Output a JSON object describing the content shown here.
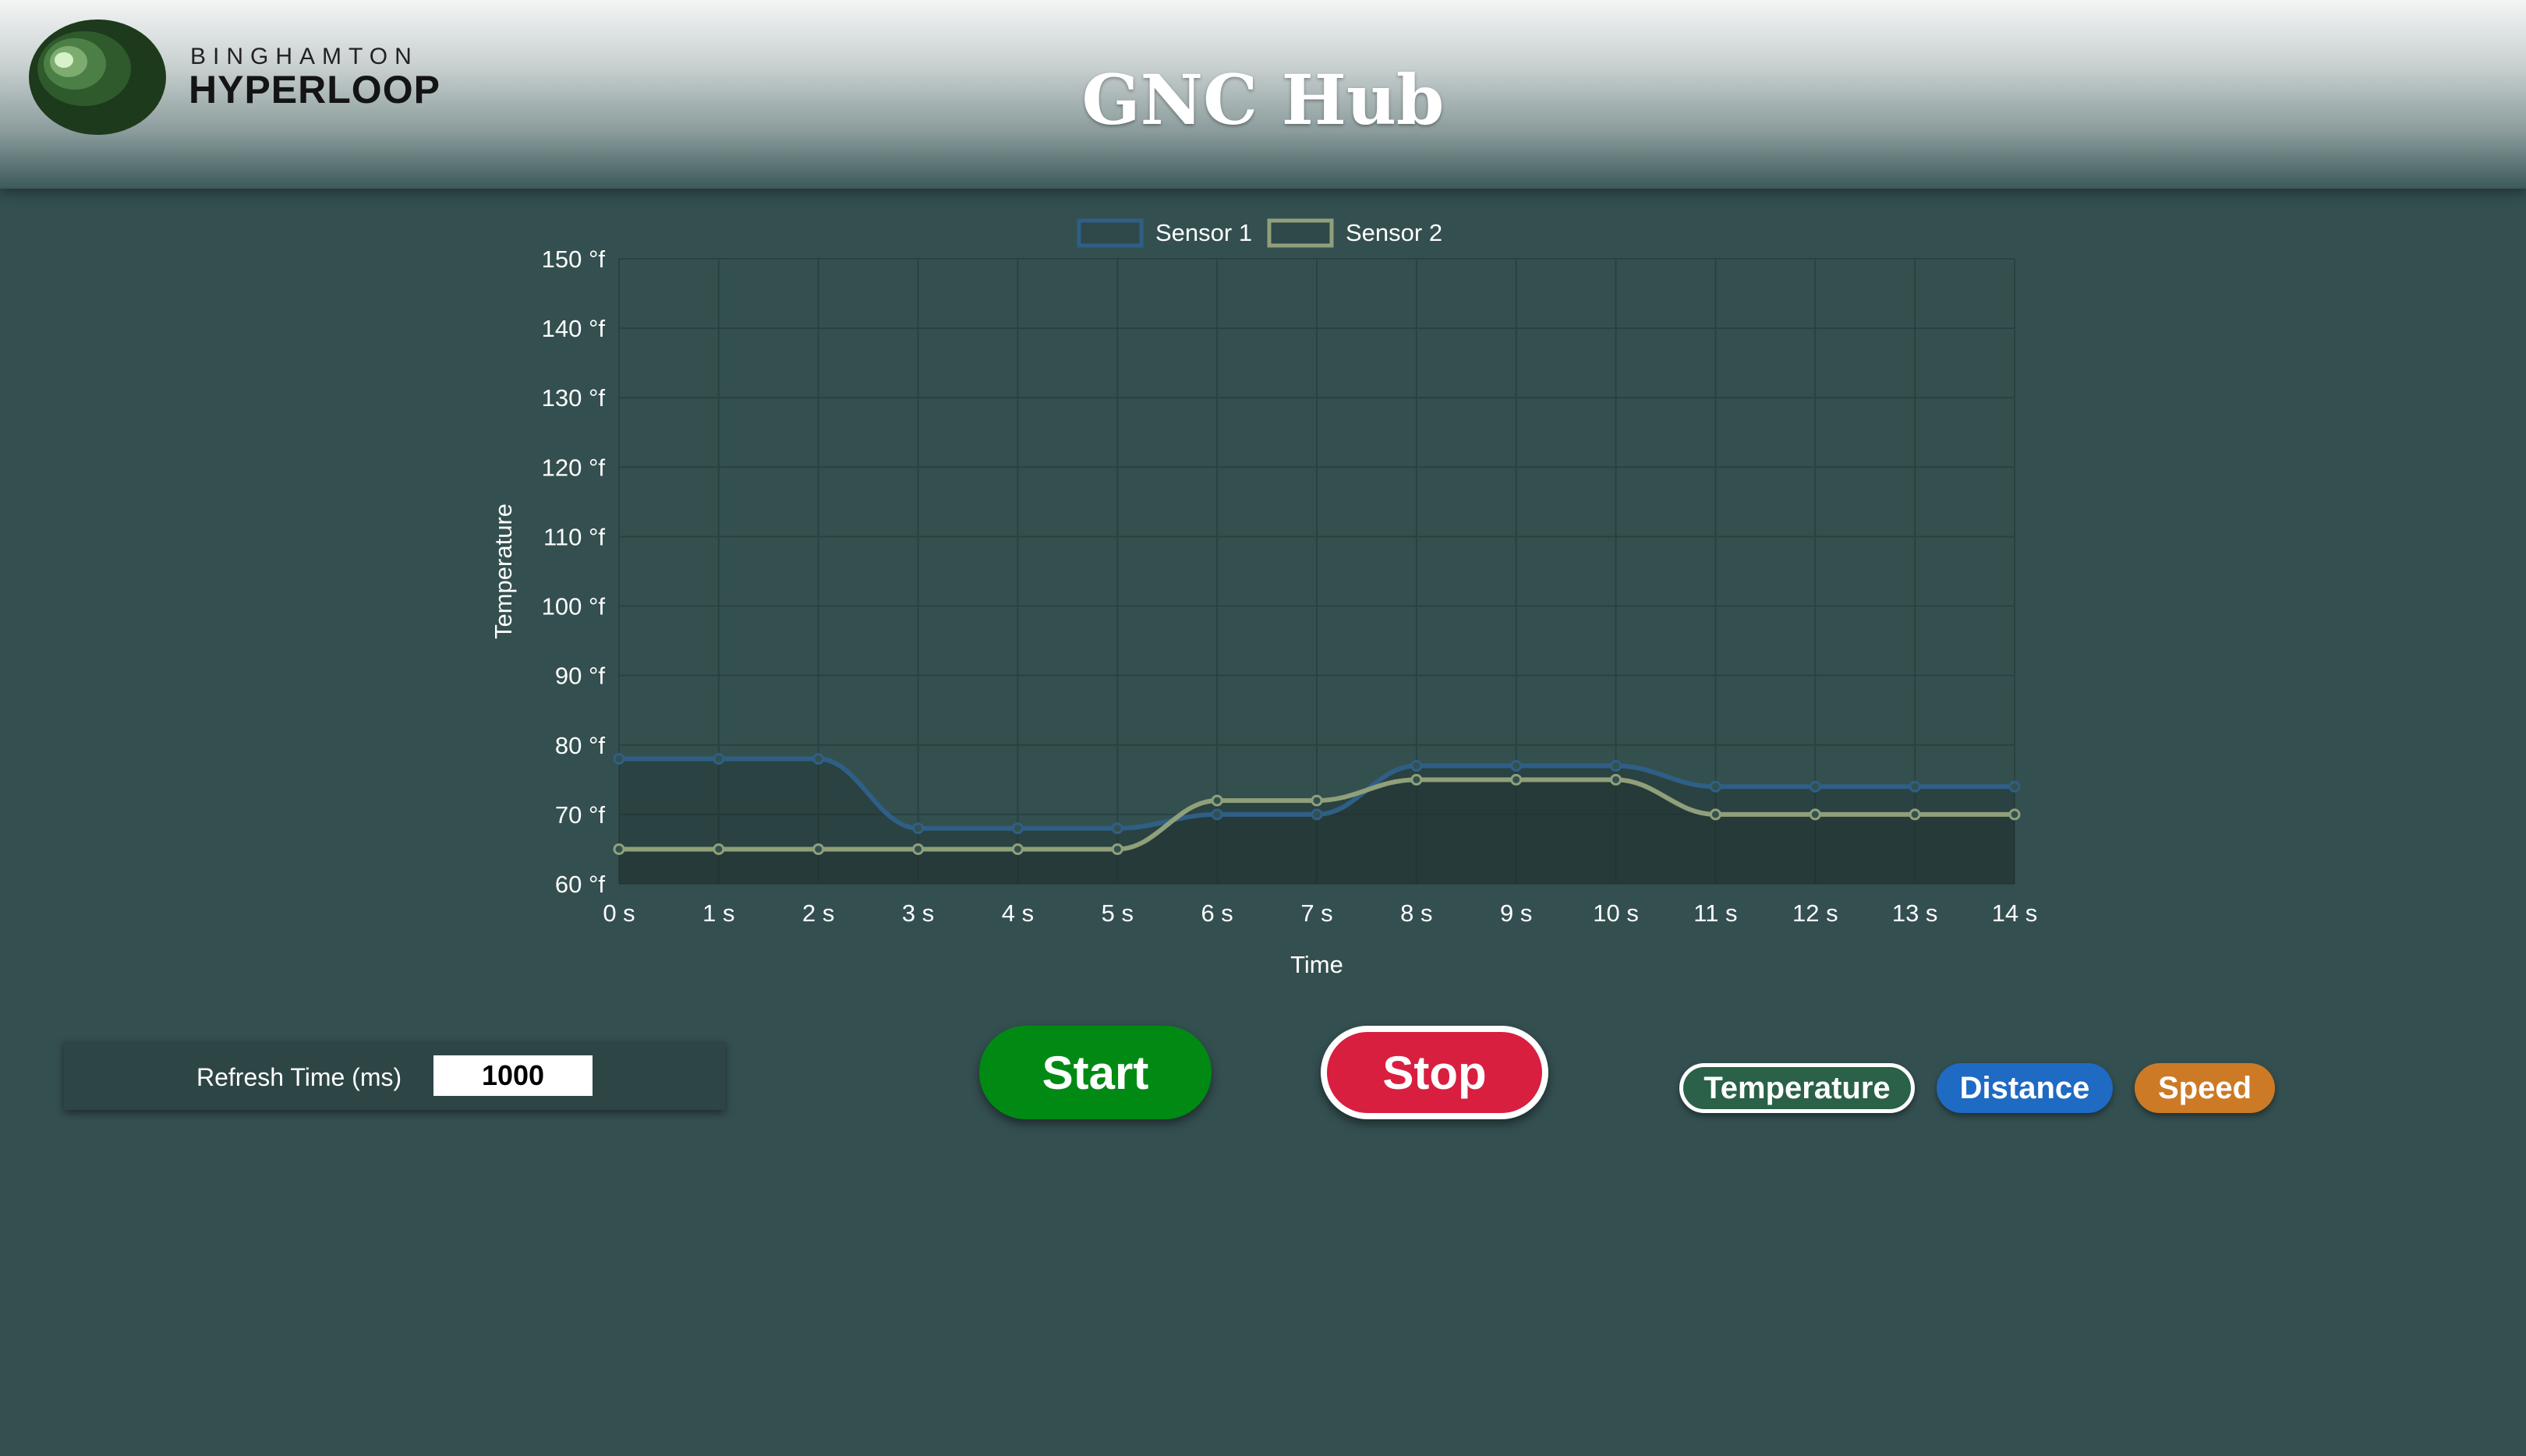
{
  "header": {
    "logo_top": "BINGHAMTON",
    "logo_bottom": "HYPERLOOP",
    "title": "GNC Hub"
  },
  "chart_data": {
    "type": "line",
    "x": [
      0,
      1,
      2,
      3,
      4,
      5,
      6,
      7,
      8,
      9,
      10,
      11,
      12,
      13,
      14
    ],
    "tick_labels": [
      "0 s",
      "1 s",
      "2 s",
      "3 s",
      "4 s",
      "5 s",
      "6 s",
      "7 s",
      "8 s",
      "9 s",
      "10 s",
      "11 s",
      "12 s",
      "13 s",
      "14 s"
    ],
    "y_tick_labels": [
      "60 °f",
      "70 °f",
      "80 °f",
      "90 °f",
      "100 °f",
      "110 °f",
      "120 °f",
      "130 °f",
      "140 °f",
      "150 °f"
    ],
    "ylim": [
      60,
      150
    ],
    "xlabel": "Time",
    "ylabel": "Temperature",
    "grid": true,
    "legend_position": "top",
    "series": [
      {
        "name": "Sensor 1",
        "color": "#2f5f86",
        "values": [
          78,
          78,
          78,
          68,
          68,
          68,
          70,
          70,
          77,
          77,
          77,
          74,
          74,
          74,
          74
        ]
      },
      {
        "name": "Sensor 2",
        "color": "#8fa07a",
        "values": [
          65,
          65,
          65,
          65,
          65,
          65,
          72,
          72,
          75,
          75,
          75,
          70,
          70,
          70,
          70
        ]
      }
    ]
  },
  "controls": {
    "refresh_label": "Refresh Time (ms)",
    "refresh_value": "1000",
    "start_label": "Start",
    "stop_label": "Stop"
  },
  "metric_tabs": {
    "temperature": "Temperature",
    "distance": "Distance",
    "speed": "Speed",
    "colors": {
      "temperature": "#2a6148",
      "distance": "#1f6ac3",
      "speed": "#cc7a25",
      "start": "#008a14",
      "stop": "#d81f40"
    }
  }
}
